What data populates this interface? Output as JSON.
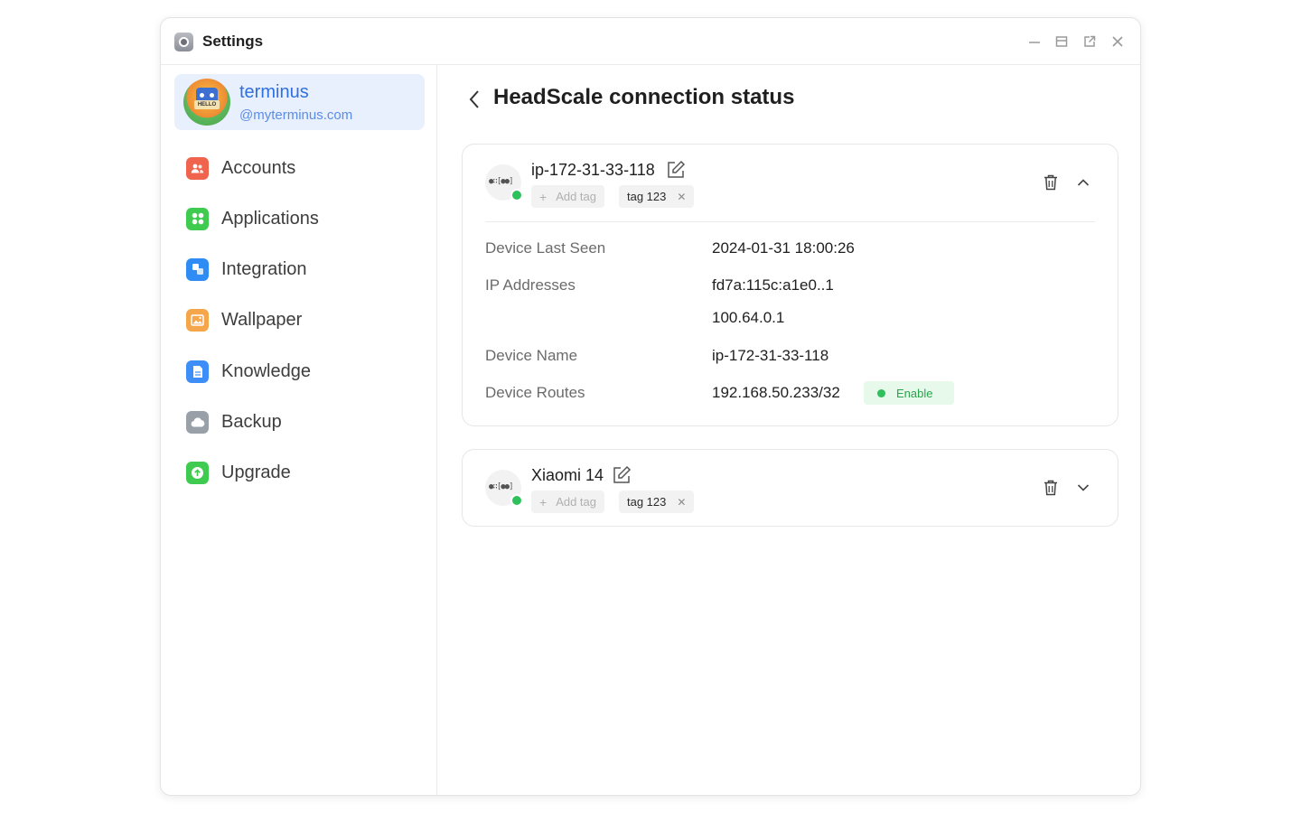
{
  "window": {
    "title": "Settings"
  },
  "user": {
    "name": "terminus",
    "domain": "@myterminus.com",
    "avatar_sign": "HELLO"
  },
  "sidebar": {
    "items": [
      {
        "label": "Accounts",
        "icon": "accounts-icon",
        "color": "#f0634d"
      },
      {
        "label": "Applications",
        "icon": "applications-icon",
        "color": "#3fcb4f"
      },
      {
        "label": "Integration",
        "icon": "integration-icon",
        "color": "#2f8cf5"
      },
      {
        "label": "Wallpaper",
        "icon": "wallpaper-icon",
        "color": "#f6a64a"
      },
      {
        "label": "Knowledge",
        "icon": "knowledge-icon",
        "color": "#3d8ef6"
      },
      {
        "label": "Backup",
        "icon": "backup-icon",
        "color": "#9aa0a8"
      },
      {
        "label": "Upgrade",
        "icon": "upgrade-icon",
        "color": "#3fcb4f"
      }
    ]
  },
  "main": {
    "title": "HeadScale connection status"
  },
  "devices": [
    {
      "name": "ip-172-31-33-118",
      "add_tag_label": "Add tag",
      "tags": [
        "tag 123"
      ],
      "expanded": true,
      "details": {
        "last_seen_label": "Device Last Seen",
        "last_seen": "2024-01-31 18:00:26",
        "ip_label": "IP Addresses",
        "ip_addresses": [
          "fd7a:115c:a1e0..1",
          "100.64.0.1"
        ],
        "name_label": "Device Name",
        "device_name": "ip-172-31-33-118",
        "routes_label": "Device Routes",
        "route": "192.168.50.233/32",
        "route_status": "Enable"
      }
    },
    {
      "name": "Xiaomi 14",
      "add_tag_label": "Add tag",
      "tags": [
        "tag 123"
      ],
      "expanded": false
    }
  ],
  "colors": {
    "accent": "#2f6fe0",
    "online": "#2ec05a",
    "enable_bg": "#e6f9eb"
  }
}
